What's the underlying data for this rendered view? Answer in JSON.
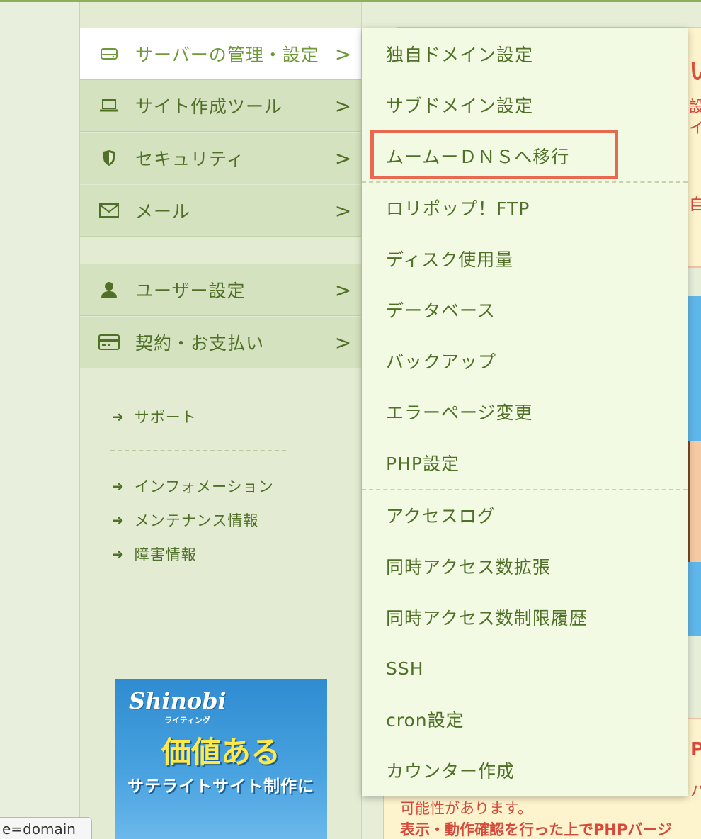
{
  "sidebar": {
    "items": [
      {
        "label": "サーバーの管理・設定",
        "icon": "server-icon",
        "active": true
      },
      {
        "label": "サイト作成ツール",
        "icon": "laptop-icon",
        "active": false
      },
      {
        "label": "セキュリティ",
        "icon": "shield-icon",
        "active": false
      },
      {
        "label": "メール",
        "icon": "mail-icon",
        "active": false
      },
      {
        "label": "ユーザー設定",
        "icon": "user-icon",
        "active": false
      },
      {
        "label": "契約・お支払い",
        "icon": "credit-card-icon",
        "active": false
      }
    ],
    "chevron": ">",
    "links_primary": [
      {
        "label": "サポート"
      }
    ],
    "links_secondary": [
      {
        "label": "インフォメーション"
      },
      {
        "label": "メンテナンス情報"
      },
      {
        "label": "障害情報"
      }
    ],
    "arrow": "➜"
  },
  "submenu": {
    "items": [
      "独自ドメイン設定",
      "サブドメイン設定",
      "ムームーＤＮＳへ移行",
      "ロリポップ！FTP",
      "ディスク使用量",
      "データベース",
      "バックアップ",
      "エラーページ変更",
      "PHP設定",
      "アクセスログ",
      "同時アクセス数拡張",
      "同時アクセス数制限履歴",
      "SSH",
      "cron設定",
      "カウンター作成"
    ],
    "highlighted_item": "ムームーＤＮＳへ移行",
    "highlight_color": "#e8694f"
  },
  "banner": {
    "logo": "Shinobi",
    "logo_sub": "ライティング",
    "headline": "価値ある",
    "subline": "サテライトサイト制作に"
  },
  "background": {
    "fragment_top_1": "い",
    "fragment_top_2": "設",
    "fragment_top_3": "イ",
    "fragment_mid": "自",
    "fragment_p": "P",
    "fragment_ha": "ハ",
    "notice_line_1": "可能性があります。",
    "notice_line_2": "表示・動作確認を行った上でPHPバージ"
  },
  "tooltip": {
    "text": "e=domain"
  },
  "colors": {
    "sidebar_bg": "#d5e2bf",
    "active_bg": "#ffffff",
    "text_green": "#4f7026",
    "dropdown_bg": "#f3fae3",
    "highlight": "#e8694f"
  }
}
